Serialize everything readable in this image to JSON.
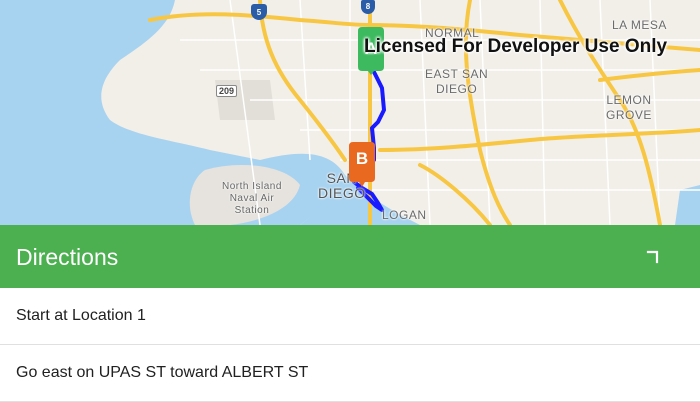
{
  "map": {
    "watermark": "Licensed For Developer Use Only",
    "labels": {
      "normal": "NORMAL",
      "la_mesa": "LA MESA",
      "east_san_diego": "EAST SAN\nDIEGO",
      "lemon_grove": "LEMON\nGROVE",
      "san_diego": "SAN\nDIEGO",
      "north_island": "North Island\nNaval Air\nStation",
      "logan": "LOGAN"
    },
    "shields": {
      "i5": "5",
      "i8": "8",
      "sr209": "209"
    },
    "pins": {
      "start": "A",
      "end": "B"
    },
    "colors": {
      "route": "#1a1aff",
      "pin_start": "#3dba5f",
      "pin_end": "#e8691f",
      "water": "#a8d3f0",
      "land": "#f2efe9"
    }
  },
  "panel": {
    "title": "Directions",
    "collapse_icon": "chevron-down-icon",
    "steps": [
      "Start at Location 1",
      "Go east on UPAS ST toward ALBERT ST"
    ]
  }
}
